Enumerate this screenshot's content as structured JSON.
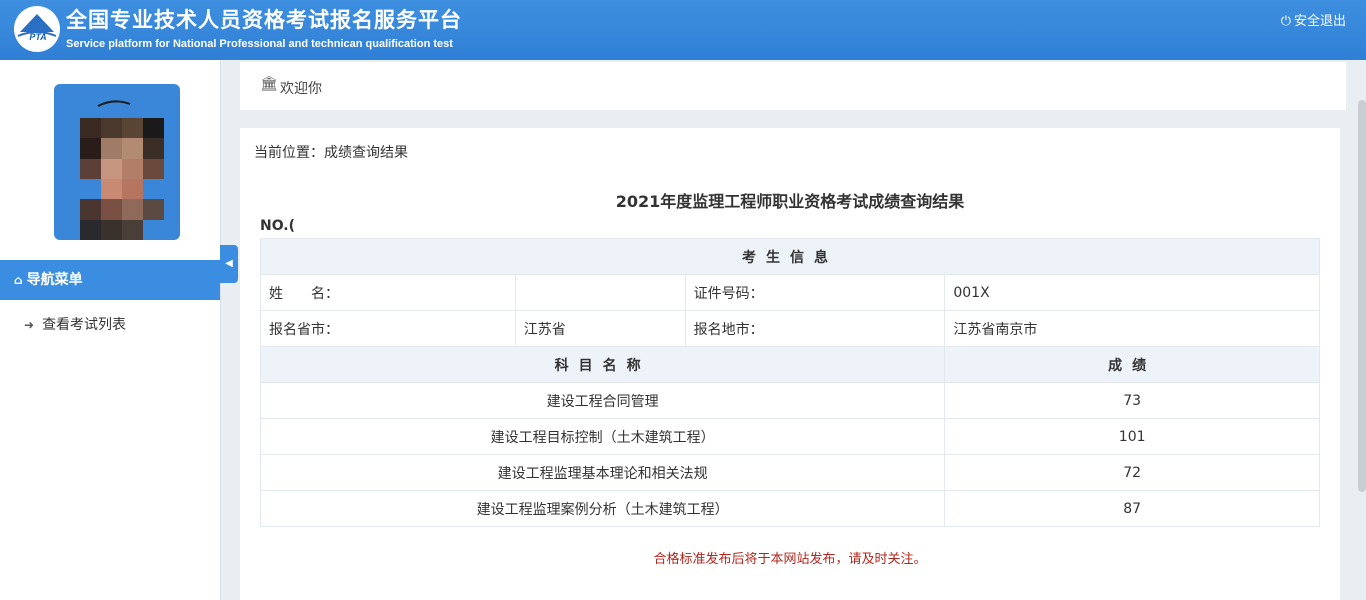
{
  "header": {
    "logo_text": "PTA",
    "title_cn": "全国专业技术人员资格考试报名服务平台",
    "title_en": "Service platform for National Professional and technican qualification test",
    "logout_label": "安全退出"
  },
  "sidebar": {
    "nav_menu_label": "导航菜单",
    "items": [
      {
        "label": "查看考试列表"
      }
    ]
  },
  "welcome": {
    "text": "欢迎你"
  },
  "main": {
    "breadcrumb": "当前位置：成绩查询结果",
    "result_title": "2021年度监理工程师职业资格考试成绩查询结果",
    "cert_no": "NO.(",
    "candidate_section": "考生信息",
    "candidate": {
      "name_label": "姓　　名：",
      "name_value": "",
      "id_label": "证件号码：",
      "id_value": "001X",
      "province_label": "报名省市：",
      "province_value": "江苏省",
      "city_label": "报名地市：",
      "city_value": "江苏省南京市"
    },
    "subjects_header": "科目名称",
    "score_header": "成绩",
    "subjects": [
      {
        "name": "建设工程合同管理",
        "score": "73"
      },
      {
        "name": "建设工程目标控制（土木建筑工程）",
        "score": "101"
      },
      {
        "name": "建设工程监理基本理论和相关法规",
        "score": "72"
      },
      {
        "name": "建设工程监理案例分析（土木建筑工程）",
        "score": "87"
      }
    ],
    "notice": "合格标准发布后将于本网站发布，请及时关注。"
  },
  "colors": {
    "header_bg": "#3a8ae0",
    "nav_active_bg": "#3a8de0",
    "notice_red": "#b3261e"
  }
}
